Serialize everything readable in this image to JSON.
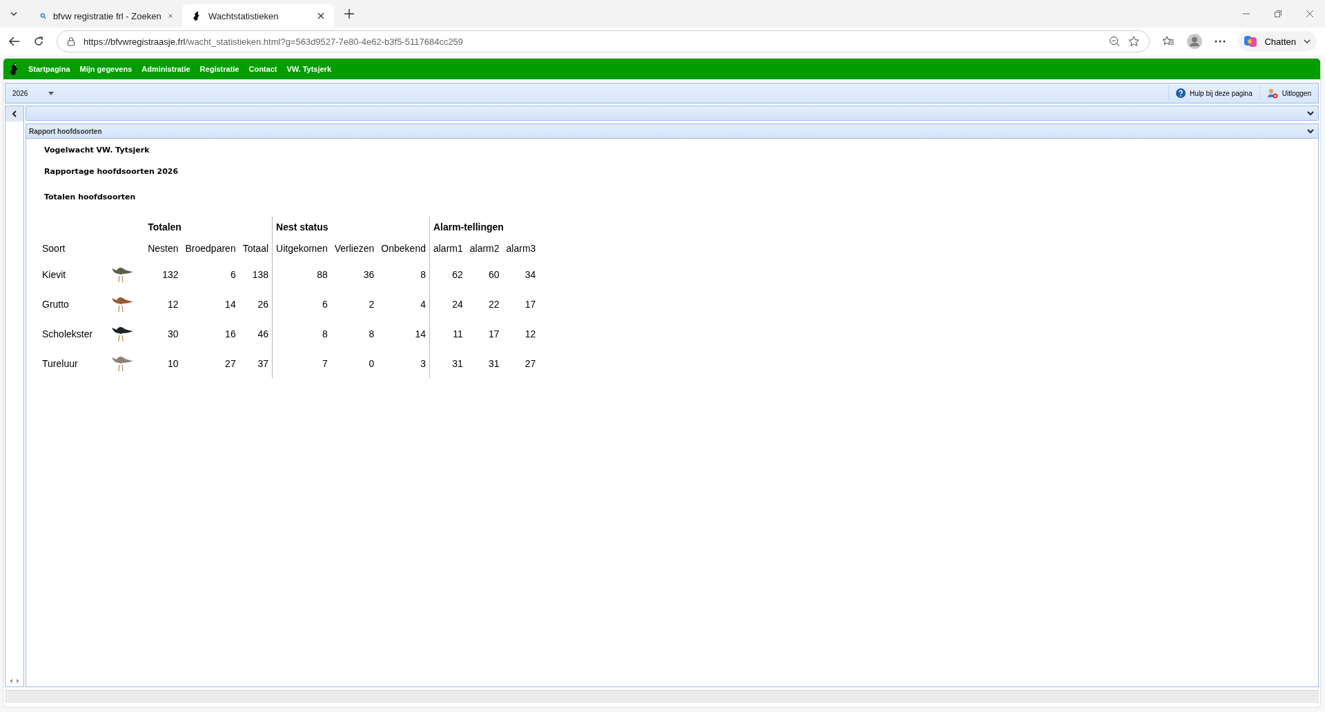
{
  "browser": {
    "tabs": [
      {
        "title": "bfvw registratie frl - Zoeken",
        "kind": "search",
        "selected": false
      },
      {
        "title": "Wachtstatistieken",
        "kind": "site",
        "selected": true
      }
    ],
    "url_host": "https://bfvwregistraasje.frl",
    "url_path": "/wacht_statistieken.html?g=563d9527-7e80-4e62-b3f5-5117684cc259",
    "chat_label": "Chatten"
  },
  "nav": {
    "items": [
      "Startpagina",
      "Mijn gegevens",
      "Administratie",
      "Registratie",
      "Contact",
      "VW. Tytsjerk"
    ]
  },
  "toolbar": {
    "year": "2026",
    "help": "Hulp bij deze pagina",
    "logout": "Uitloggen"
  },
  "panel": {
    "title": "Rapport hoofdsoorten",
    "heading": "Vogelwacht VW. Tytsjerk",
    "subheading": "Rapportage hoofdsoorten 2026",
    "section": "Totalen hoofdsoorten"
  },
  "table": {
    "groups": [
      "Totalen",
      "Nest status",
      "Alarm-tellingen"
    ],
    "columns": [
      "Soort",
      "Nesten",
      "Broedparen",
      "Totaal",
      "Uitgekomen",
      "Verliezen",
      "Onbekend",
      "alarm1",
      "alarm2",
      "alarm3"
    ],
    "rows": [
      {
        "name": "Kievit",
        "color": "#5b6048",
        "values": [
          "132",
          "6",
          "138",
          "88",
          "36",
          "8",
          "62",
          "60",
          "34"
        ]
      },
      {
        "name": "Grutto",
        "color": "#9a5a32",
        "values": [
          "12",
          "14",
          "26",
          "6",
          "2",
          "4",
          "24",
          "22",
          "17"
        ]
      },
      {
        "name": "Scholekster",
        "color": "#1e2328",
        "values": [
          "30",
          "16",
          "46",
          "8",
          "8",
          "14",
          "11",
          "17",
          "12"
        ]
      },
      {
        "name": "Tureluur",
        "color": "#8c8378",
        "values": [
          "10",
          "27",
          "37",
          "7",
          "0",
          "3",
          "31",
          "31",
          "27"
        ]
      }
    ]
  }
}
